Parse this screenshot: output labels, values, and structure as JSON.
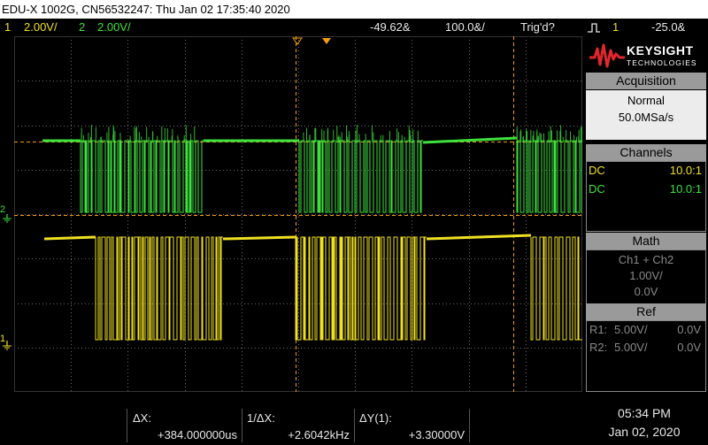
{
  "title_bar": "EDU-X 1002G, CN56532247: Thu Jan 02 17:35:40 2020",
  "status": {
    "ch1_num": "1",
    "ch1_scale": "2.00V/",
    "ch2_num": "2",
    "ch2_scale": "2.00V/",
    "time_delay": "-49.62&",
    "time_scale": "100.0&/",
    "trigger_state": "Trig'd?",
    "trigger_source": "1",
    "trigger_level": "-25.0&"
  },
  "brand": {
    "name": "KEYSIGHT",
    "sub": "TECHNOLOGIES"
  },
  "acquisition": {
    "header": "Acquisition",
    "mode": "Normal",
    "rate": "50.0MSa/s"
  },
  "channels": {
    "header": "Channels",
    "rows": [
      {
        "coupling": "DC",
        "probe": "10.0:1"
      },
      {
        "coupling": "DC",
        "probe": "10.0:1"
      }
    ]
  },
  "math": {
    "header": "Math",
    "function": "Ch1 + Ch2",
    "scale": "1.00V/",
    "offset": "0.0V"
  },
  "ref": {
    "header": "Ref",
    "rows": [
      {
        "name": "R1:",
        "scale": "5.00V/",
        "offset": "0.0V"
      },
      {
        "name": "R2:",
        "scale": "5.00V/",
        "offset": "0.0V"
      }
    ]
  },
  "measurements": {
    "dx_label": "ΔX:",
    "dx_value": "+384.000000us",
    "inv_dx_label": "1/ΔX:",
    "inv_dx_value": "+2.6042kHz",
    "dy_label": "ΔY(1):",
    "dy_value": "+3.30000V"
  },
  "clock": {
    "time": "05:34 PM",
    "date": "Jan 02, 2020"
  },
  "markers": {
    "ch2_marker": "2",
    "ch1_marker": "1"
  },
  "colors": {
    "ch1": "#f0e022",
    "ch2": "#3de23d",
    "cursor": "#f39c12",
    "grid": "#6a6a6a"
  }
}
